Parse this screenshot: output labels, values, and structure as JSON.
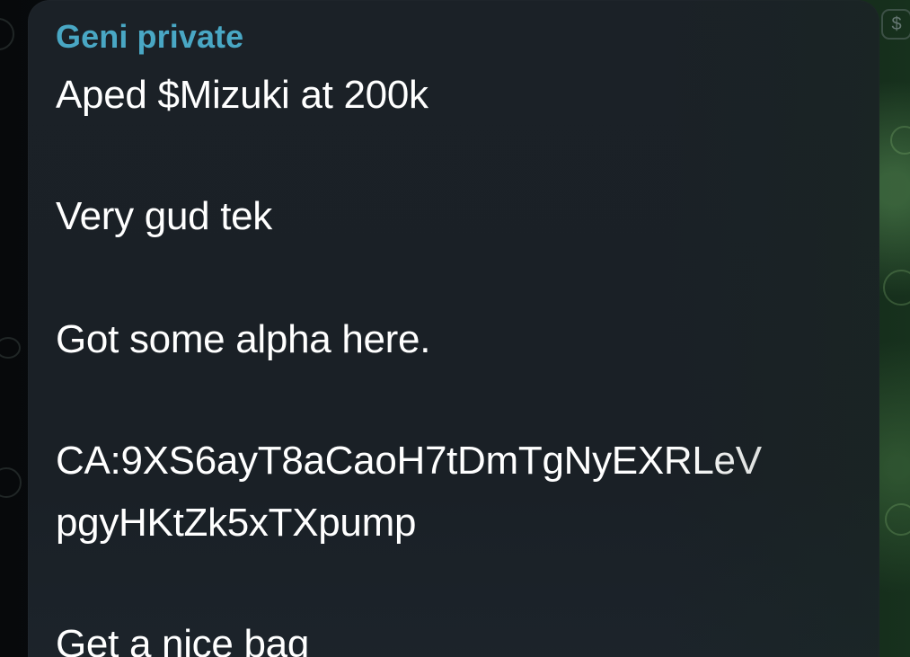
{
  "message": {
    "sender": "Geni private",
    "lines": [
      "Aped $Mizuki at 200k",
      "Very gud tek",
      "Got some alpha here.",
      "CA:9XS6ayT8aCaoH7tDmTgNyEXRLeV",
      "pgyHKtZk5xTXpump",
      "Get a nice bag"
    ]
  },
  "icons": {
    "corner": "dollar-sticker-icon"
  },
  "colors": {
    "sender": "#49a7c4",
    "bubble": "#1b2127",
    "text": "#ffffff"
  }
}
